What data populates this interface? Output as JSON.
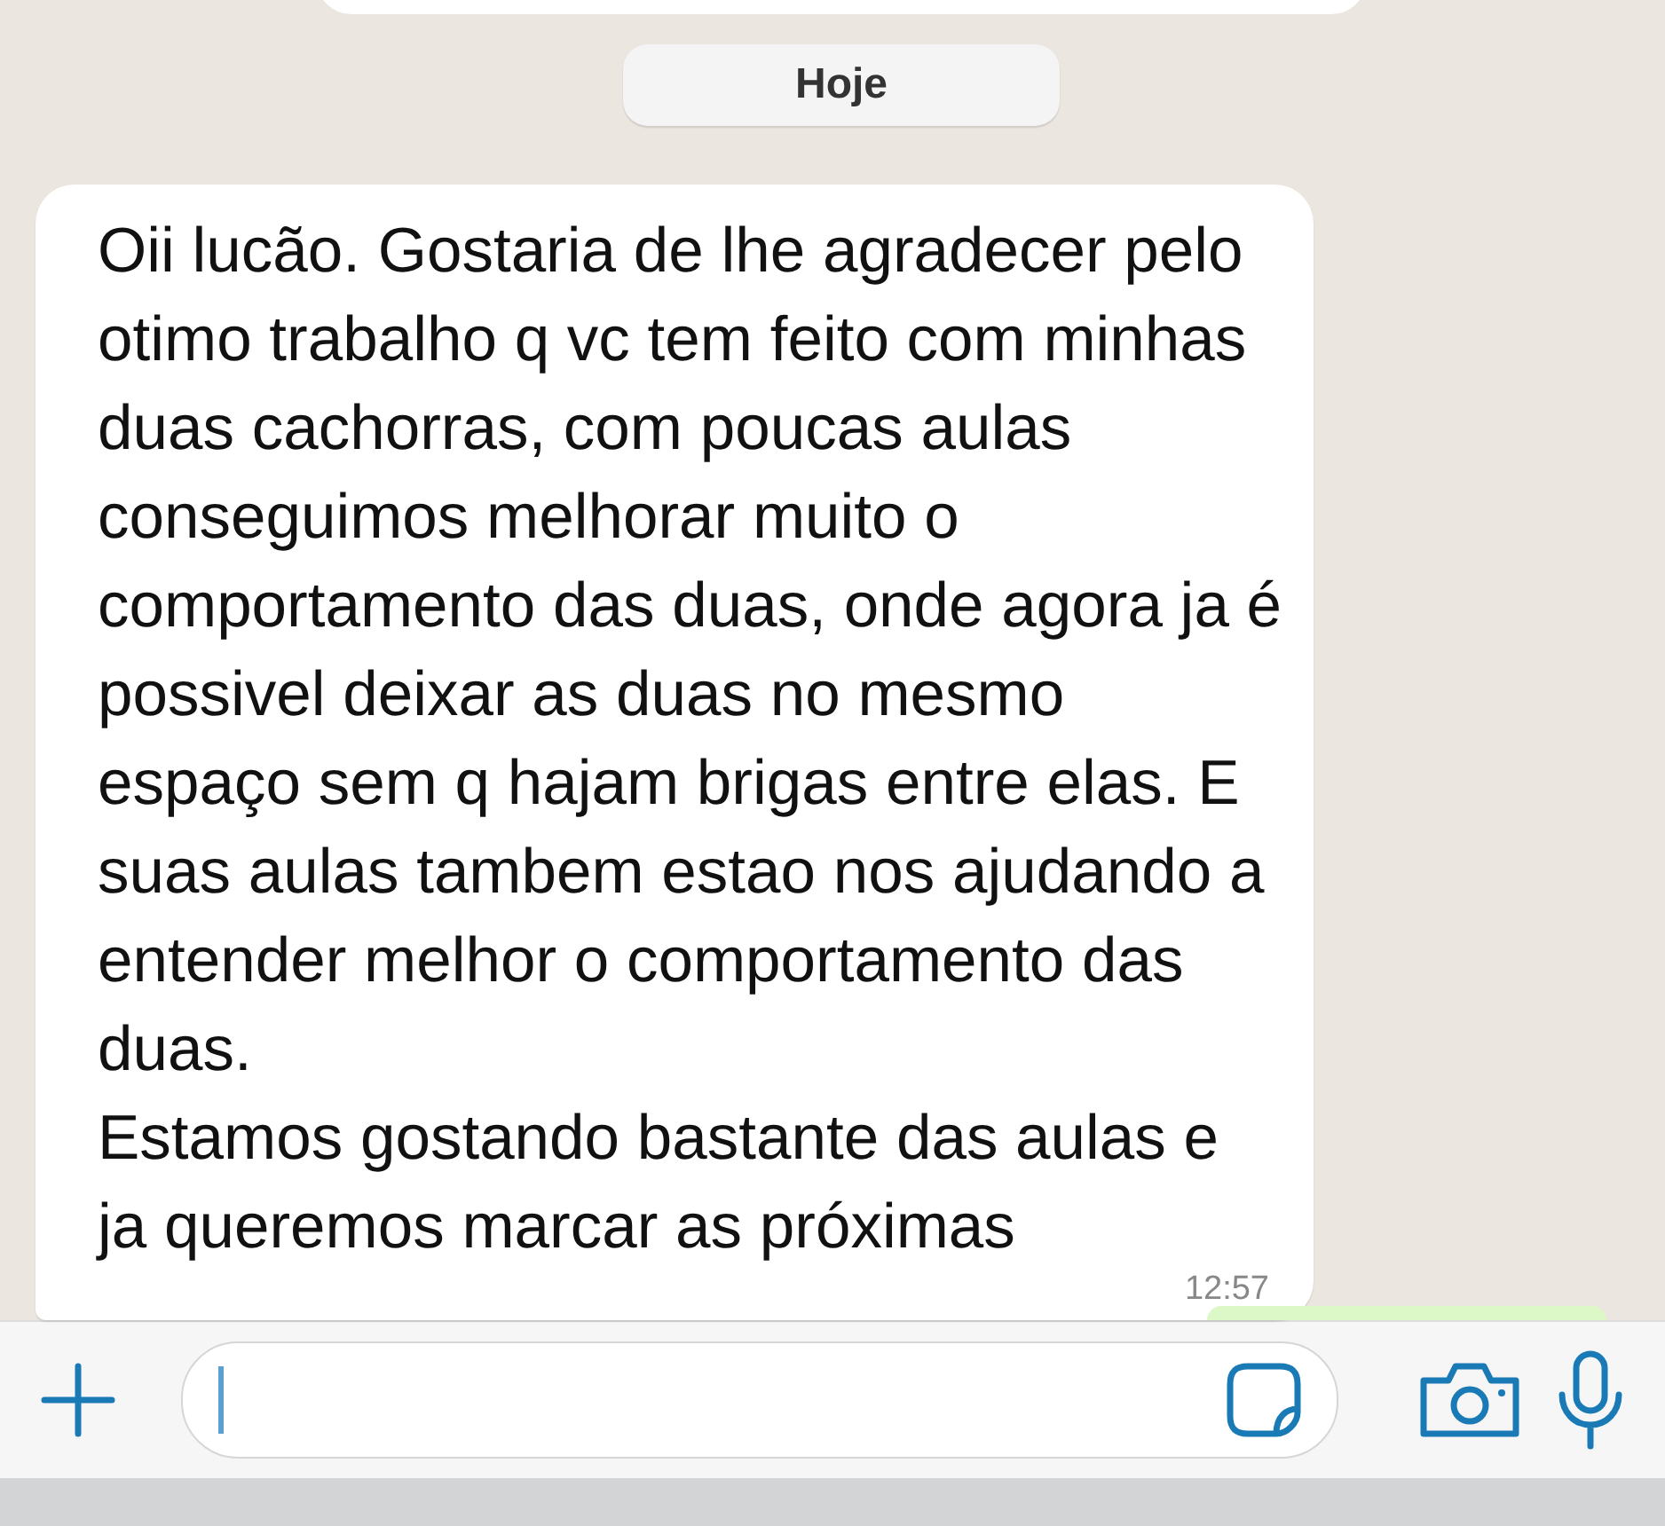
{
  "date_divider": "Hoje",
  "messages": [
    {
      "kind": "incoming",
      "text": "Oii lucão. Gostaria de lhe agradecer pelo otimo trabalho q vc tem feito com minhas duas cachorras, com poucas aulas conseguimos melhorar muito o comportamento das duas, onde agora ja é possivel deixar as duas no mesmo espaço sem q hajam brigas entre elas. E suas aulas tambem estao nos ajudando a entender melhor o comportamento das duas.\nEstamos gostando bastante das aulas e ja queremos marcar as próximas",
      "time": "12:57"
    }
  ]
}
